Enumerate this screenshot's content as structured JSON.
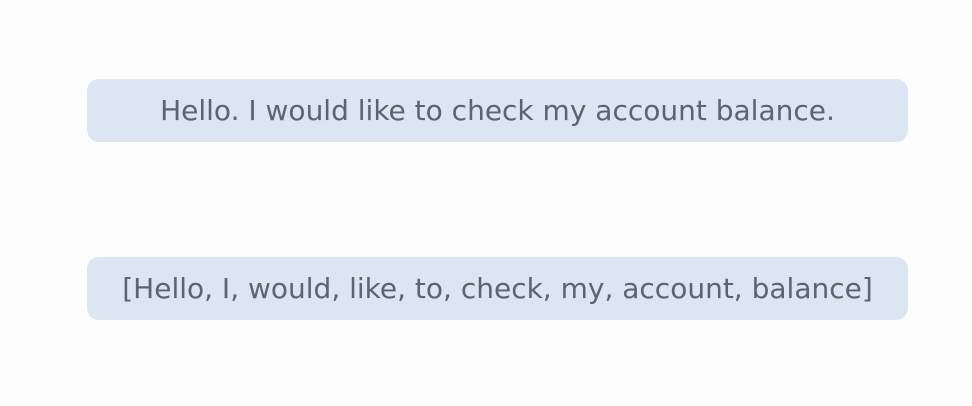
{
  "sentence": {
    "text": "Hello. I would like to check my account balance."
  },
  "tokens": {
    "text": "[Hello, I, would, like, to, check, my, account, balance]"
  },
  "colors": {
    "background": "#fdfdfd",
    "box_fill": "#dbe6f2",
    "text": "#5b6470"
  }
}
